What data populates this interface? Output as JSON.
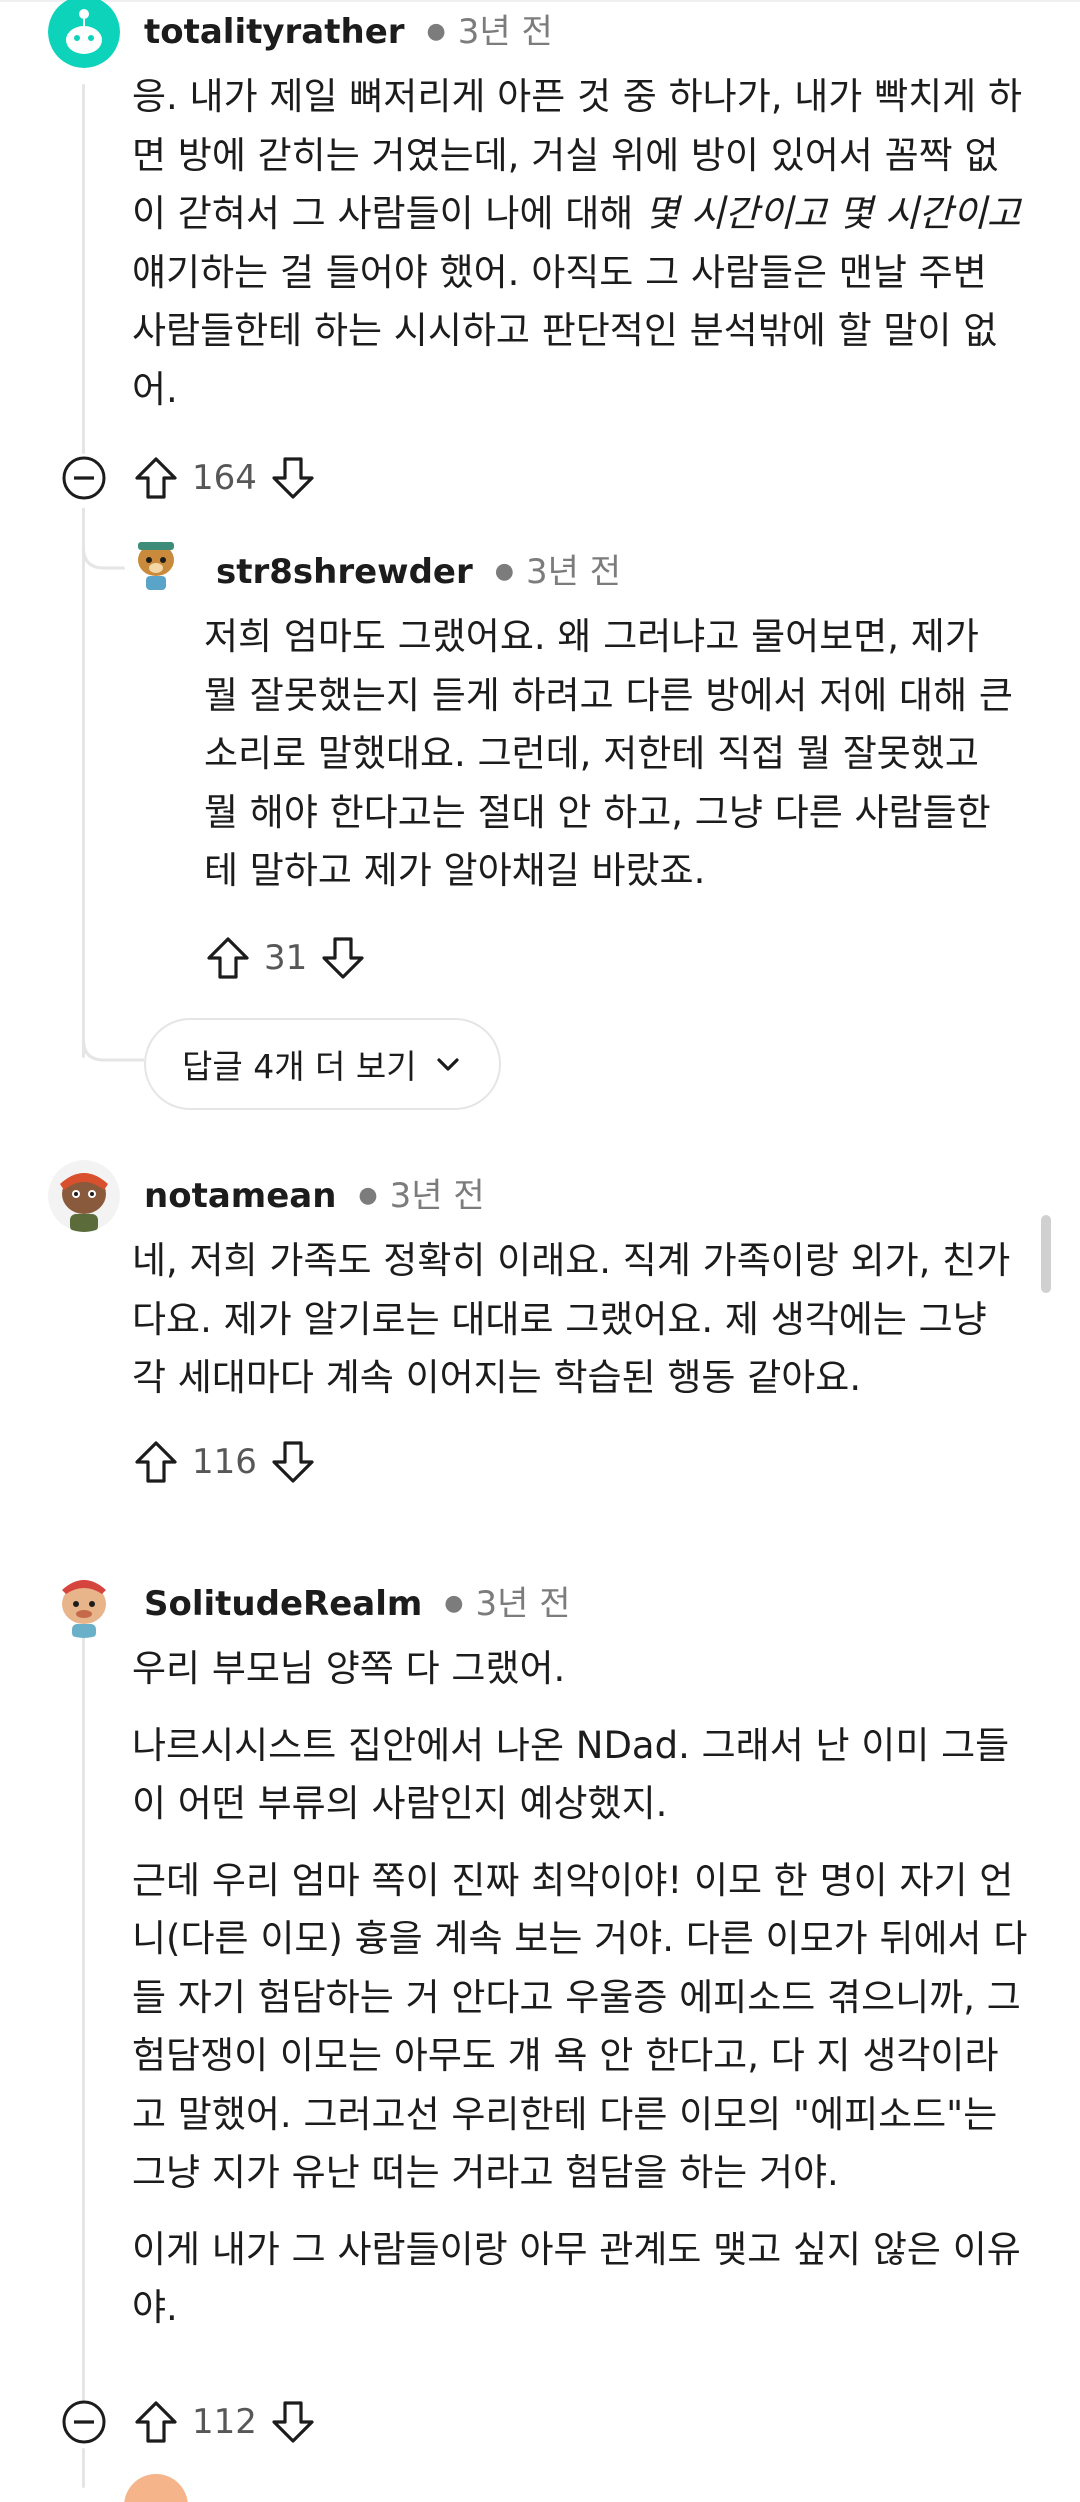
{
  "comments": [
    {
      "username": "totalityrather",
      "time": "3년 전",
      "body_html": "응. 내가 제일 뼈저리게 아픈 것 중 하나가, 내가 빡치게 하면 방에 갇히는 거였는데, 거실 위에 방이 있어서 꼼짝 없이 갇혀서 그 사람들이 나에 대해 <i>몇 시간이고 몇 시간이고</i> 얘기하는 걸 들어야 했어. 아직도 그 사람들은 맨날 주변 사람들한테 하는 시시하고 판단적인 분석밖에 할 말이 없어.",
      "score": "164"
    },
    {
      "username": "str8shrewder",
      "time": "3년 전",
      "body": "저희 엄마도 그랬어요. 왜 그러냐고 물어보면, 제가 뭘 잘못했는지 듣게 하려고 다른 방에서 저에 대해 큰 소리로 말했대요. 그런데, 저한테 직접 뭘 잘못했고 뭘 해야 한다고는 절대 안 하고, 그냥 다른 사람들한테 말하고 제가 알아채길 바랐죠.",
      "score": "31"
    },
    {
      "username": "notamean",
      "time": "3년 전",
      "body": "네, 저희 가족도 정확히 이래요. 직계 가족이랑 외가, 친가 다요. 제가 알기로는 대대로 그랬어요. 제 생각에는 그냥 각 세대마다 계속 이어지는 학습된 행동 같아요.",
      "score": "116"
    },
    {
      "username": "SolitudeRealm",
      "time": "3년 전",
      "paragraphs": [
        "우리 부모님 양쪽 다 그랬어.",
        "나르시시스트 집안에서 나온 NDad. 그래서 난 이미 그들이 어떤 부류의 사람인지 예상했지.",
        "근데 우리 엄마 쪽이 진짜 최악이야! 이모 한 명이 자기 언니(다른 이모) 흉을 계속 보는 거야. 다른 이모가 뒤에서 다들 자기 험담하는 거 안다고 우울증 에피소드 겪으니까, 그 험담쟁이 이모는 아무도 걔 욕 안 한다고, 다 지 생각이라고 말했어. 그러고선 우리한테 다른 이모의 \"에피소드\"는 그냥 지가 유난 떠는 거라고 험담을 하는 거야.",
        "이게 내가 그 사람들이랑 아무 관계도 맺고 싶지 않은 이유야."
      ],
      "score": "112"
    }
  ],
  "more_replies_label": "답글 4개 더 보기",
  "icons": {
    "upvote": "arrow-up-icon",
    "downvote": "arrow-down-icon",
    "collapse": "minus-circle-icon",
    "expand": "chevron-down-icon"
  },
  "colors": {
    "text": "#1c1c1c",
    "meta": "#7c7c7c",
    "thread_line": "#e5e5e5",
    "first_avatar_bg": "#0dd3bb"
  }
}
